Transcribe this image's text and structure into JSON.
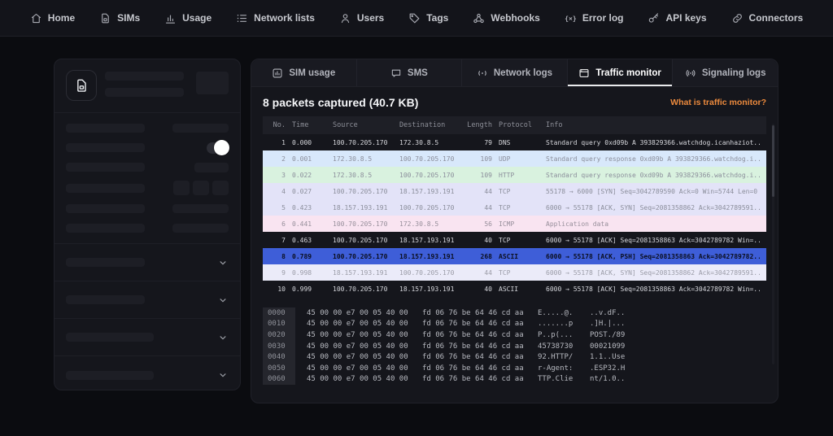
{
  "nav": {
    "items": [
      {
        "id": "nav-item-home",
        "label": "Home",
        "icon": "home-icon"
      },
      {
        "id": "nav-item-sims",
        "label": "SIMs",
        "icon": "sim-card-icon"
      },
      {
        "id": "nav-item-usage",
        "label": "Usage",
        "icon": "bar-chart-icon"
      },
      {
        "id": "nav-item-network-lists",
        "label": "Network lists",
        "icon": "list-icon"
      },
      {
        "id": "nav-item-users",
        "label": "Users",
        "icon": "user-icon"
      },
      {
        "id": "nav-item-tags",
        "label": "Tags",
        "icon": "tag-icon"
      },
      {
        "id": "nav-item-webhooks",
        "label": "Webhooks",
        "icon": "webhook-icon"
      },
      {
        "id": "nav-item-error-log",
        "label": "Error log",
        "icon": "error-brackets-icon"
      },
      {
        "id": "nav-item-api-keys",
        "label": "API keys",
        "icon": "key-icon"
      },
      {
        "id": "nav-item-connectors",
        "label": "Connectors",
        "icon": "link-icon"
      }
    ]
  },
  "tabs": [
    {
      "id": "tab-sim-usage",
      "label": "SIM usage",
      "icon": "sim-usage-icon",
      "state": ""
    },
    {
      "id": "tab-sms",
      "label": "SMS",
      "icon": "chat-bubble-icon",
      "state": ""
    },
    {
      "id": "tab-network-logs",
      "label": "Network logs",
      "icon": "radio-waves-icon",
      "state": ""
    },
    {
      "id": "tab-traffic-monitor",
      "label": "Traffic monitor",
      "icon": "browser-window-icon",
      "state": "active"
    },
    {
      "id": "tab-signaling-logs",
      "label": "Signaling logs",
      "icon": "broadcast-icon",
      "state": ""
    }
  ],
  "packets": {
    "title": "8 packets captured (40.7 KB)",
    "help_link": "What is traffic monitor?"
  },
  "table": {
    "columns": [
      "No.",
      "Time",
      "Source",
      "Destination",
      "Length",
      "Protocol",
      "Info"
    ],
    "rows": [
      {
        "id": "packet-row-1",
        "variant": "dark",
        "no": "1",
        "time": "0.000",
        "source": "100.70.205.170",
        "destination": "172.30.8.5",
        "length": "79",
        "protocol": "DNS",
        "info": "Standard query 0xd09b A 393829366.watchdog.icanhaziot..."
      },
      {
        "id": "packet-row-2",
        "variant": "blue",
        "no": "2",
        "time": "0.001",
        "source": "172.30.8.5",
        "destination": "100.70.205.170",
        "length": "109",
        "protocol": "UDP",
        "info": "Standard query response 0xd09b A 393829366.watchdog.i..."
      },
      {
        "id": "packet-row-3",
        "variant": "green",
        "no": "3",
        "time": "0.022",
        "source": "172.30.8.5",
        "destination": "100.70.205.170",
        "length": "109",
        "protocol": "HTTP",
        "info": "Standard query response 0xd09b A 393829366.watchdog.i..."
      },
      {
        "id": "packet-row-4",
        "variant": "lavender",
        "no": "4",
        "time": "0.027",
        "source": "100.70.205.170",
        "destination": "18.157.193.191",
        "length": "44",
        "protocol": "TCP",
        "info": "55178 → 6000 [SYN] Seq=3042789590 Ack=0 Win=5744 Len=0"
      },
      {
        "id": "packet-row-5",
        "variant": "lavender",
        "no": "5",
        "time": "0.423",
        "source": "18.157.193.191",
        "destination": "100.70.205.170",
        "length": "44",
        "protocol": "TCP",
        "info": "6000 → 55178 [ACK, SYN] Seq=2081358862 Ack=3042789591..."
      },
      {
        "id": "packet-row-6",
        "variant": "pink",
        "no": "6",
        "time": "0.441",
        "source": "100.70.205.170",
        "destination": "172.30.8.5",
        "length": "56",
        "protocol": "ICMP",
        "info": "Application data"
      },
      {
        "id": "packet-row-7",
        "variant": "dark",
        "no": "7",
        "time": "0.463",
        "source": "100.70.205.170",
        "destination": "18.157.193.191",
        "length": "40",
        "protocol": "TCP",
        "info": "6000 → 55178 [ACK] Seq=2081358863 Ack=3042789782 Win=..."
      },
      {
        "id": "packet-row-8",
        "variant": "selected",
        "no": "8",
        "time": "0.789",
        "source": "100.70.205.170",
        "destination": "18.157.193.191",
        "length": "268",
        "protocol": "ASCII",
        "info": "6000 → 55178 [ACK, PSH] Seq=2081358863 Ack=3042789782..."
      },
      {
        "id": "packet-row-9",
        "variant": "light",
        "no": "9",
        "time": "0.998",
        "source": "18.157.193.191",
        "destination": "100.70.205.170",
        "length": "44",
        "protocol": "TCP",
        "info": "6000 → 55178 [ACK, SYN] Seq=2081358862 Ack=3042789591..."
      },
      {
        "id": "packet-row-10",
        "variant": "dark",
        "no": "10",
        "time": "0.999",
        "source": "100.70.205.170",
        "destination": "18.157.193.191",
        "length": "40",
        "protocol": "ASCII",
        "info": "6000 → 55178 [ACK] Seq=2081358863 Ack=3042789782 Win=..."
      }
    ]
  },
  "hexdump": {
    "rows": [
      {
        "offset": "0000",
        "hex1": "45 00 00 e7 00 05 40 00",
        "hex2": "fd 06 76 be 64 46 cd aa",
        "ascii1": "E.....@.",
        "ascii2": "..v.dF.."
      },
      {
        "offset": "0010",
        "hex1": "45 00 00 e7 00 05 40 00",
        "hex2": "fd 06 76 be 64 46 cd aa",
        "ascii1": ".......p",
        "ascii2": ".]H.|..."
      },
      {
        "offset": "0020",
        "hex1": "45 00 00 e7 00 05 40 00",
        "hex2": "fd 06 76 be 64 46 cd aa",
        "ascii1": "P..p(...",
        "ascii2": "POST./89"
      },
      {
        "offset": "0030",
        "hex1": "45 00 00 e7 00 05 40 00",
        "hex2": "fd 06 76 be 64 46 cd aa",
        "ascii1": "45738730",
        "ascii2": "00021099"
      },
      {
        "offset": "0040",
        "hex1": "45 00 00 e7 00 05 40 00",
        "hex2": "fd 06 76 be 64 46 cd aa",
        "ascii1": "92.HTTP/",
        "ascii2": "1.1..Use"
      },
      {
        "offset": "0050",
        "hex1": "45 00 00 e7 00 05 40 00",
        "hex2": "fd 06 76 be 64 46 cd aa",
        "ascii1": "r-Agent:",
        "ascii2": ".ESP32.H"
      },
      {
        "offset": "0060",
        "hex1": "45 00 00 e7 00 05 40 00",
        "hex2": "fd 06 76 be 64 46 cd aa",
        "ascii1": "TTP.Clie",
        "ascii2": "nt/1.0.."
      }
    ]
  },
  "colors": {
    "accent_orange": "#ec8a3d",
    "selected_row_blue": "#3e5ed8",
    "row_blue": "#d8e8fb",
    "row_green": "#d9f2df",
    "row_lavender": "#e3e3f8",
    "row_pink": "#f9e4f1",
    "row_light": "#ebebf9",
    "card_background": "#15161c",
    "page_background": "#0b0c10",
    "toggle_on_knob": "#ffffff"
  }
}
